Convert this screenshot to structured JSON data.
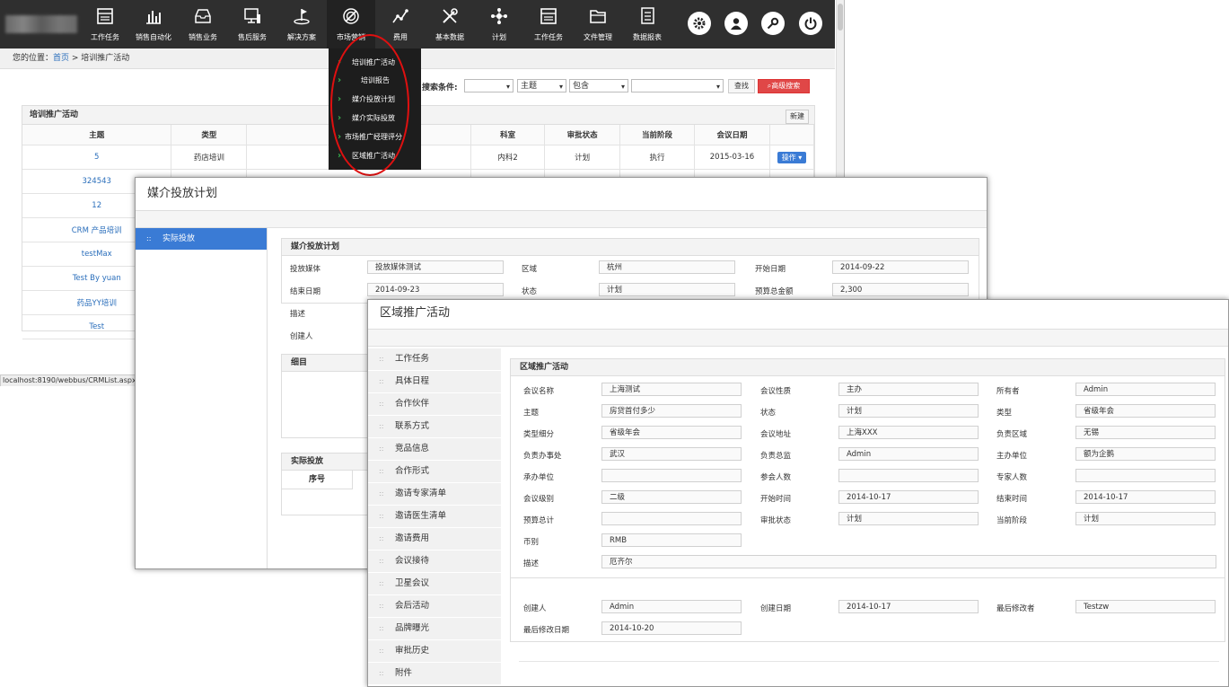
{
  "nav": {
    "items": [
      {
        "label": "工作任务",
        "icon": "task-board-icon"
      },
      {
        "label": "销售自动化",
        "icon": "bar-chart-icon"
      },
      {
        "label": "销售业务",
        "icon": "inbox-tray-icon"
      },
      {
        "label": "售后服务",
        "icon": "monitor-icon"
      },
      {
        "label": "解决方案",
        "icon": "flag-icon"
      },
      {
        "label": "市场营销",
        "icon": "target-icon"
      },
      {
        "label": "费用",
        "icon": "line-graph-icon"
      },
      {
        "label": "基本数据",
        "icon": "tools-icon"
      },
      {
        "label": "计划",
        "icon": "network-icon"
      },
      {
        "label": "工作任务",
        "icon": "task-board-icon"
      },
      {
        "label": "文件管理",
        "icon": "folder-icon"
      },
      {
        "label": "数据报表",
        "icon": "document-icon"
      }
    ],
    "round_icons": [
      "gear-icon",
      "user-icon",
      "key-icon",
      "power-icon"
    ]
  },
  "breadcrumb": {
    "prefix": "您的位置：",
    "home": "首页",
    "sep": " > ",
    "current": "培训推广活动"
  },
  "dropdown": [
    "培训推广活动",
    "培训报告",
    "媒介投放计划",
    "媒介实际投放",
    "市场推广经理评分",
    "区域推广活动"
  ],
  "search": {
    "label": "搜索条件:",
    "field1": "",
    "field2": "主题",
    "op": "包含",
    "value": "",
    "find": "查找",
    "advanced": "高级搜索"
  },
  "list_panel": {
    "title": "培训推广活动",
    "new_btn": "新建",
    "headers": [
      "主题",
      "类型",
      "",
      "科室",
      "审批状态",
      "当前阶段",
      "会议日期",
      ""
    ],
    "rows": [
      [
        "5",
        "药店培训",
        "",
        "内科2",
        "计划",
        "执行",
        "2015-03-16",
        "操作"
      ],
      [
        "324543",
        "",
        "",
        "",
        "",
        "",
        "",
        ""
      ],
      [
        "12",
        "",
        "",
        "",
        "",
        "",
        "",
        ""
      ],
      [
        "CRM 产品培训",
        "",
        "",
        "",
        "",
        "",
        "",
        ""
      ],
      [
        "testMax",
        "",
        "",
        "",
        "",
        "",
        "",
        ""
      ],
      [
        "Test By yuan",
        "",
        "",
        "",
        "",
        "",
        "",
        ""
      ],
      [
        "药品YY培训",
        "",
        "",
        "",
        "",
        "",
        "",
        ""
      ],
      [
        "Test",
        "",
        "",
        "",
        "",
        "",
        "",
        ""
      ]
    ]
  },
  "status_url": "localhost:8190/webbus/CRMList.aspx",
  "media_plan": {
    "window_title": "媒介投放计划",
    "nav": [
      "实际投放"
    ],
    "section_title": "媒介投放计划",
    "fields": [
      {
        "label": "投放媒体",
        "value": "投放媒体测试"
      },
      {
        "label": "区域",
        "value": "杭州"
      },
      {
        "label": "开始日期",
        "value": "2014-09-22"
      },
      {
        "label": "结束日期",
        "value": "2014-09-23"
      },
      {
        "label": "状态",
        "value": "计划"
      },
      {
        "label": "预算总金额",
        "value": "2,300"
      },
      {
        "label": "描述",
        "value": ""
      },
      {
        "label": "创建人",
        "value": ""
      }
    ],
    "detail_title": "细目",
    "actual_title": "实际投放",
    "actual_headers": [
      "序号"
    ]
  },
  "region": {
    "window_title": "区域推广活动",
    "tabs": [
      "工作任务",
      "具体日程",
      "合作伙伴",
      "联系方式",
      "竞品信息",
      "合作形式",
      "邀请专家清单",
      "邀请医生清单",
      "邀请费用",
      "会议接待",
      "卫星会议",
      "会后活动",
      "品牌曝光",
      "审批历史",
      "附件"
    ],
    "section_title": "区域推广活动",
    "fields": [
      {
        "label": "会议名称",
        "value": "上海测试"
      },
      {
        "label": "会议性质",
        "value": "主办"
      },
      {
        "label": "所有者",
        "value": "Admin"
      },
      {
        "label": "主题",
        "value": "房贷首付多少"
      },
      {
        "label": "状态",
        "value": "计划"
      },
      {
        "label": "类型",
        "value": "省级年会"
      },
      {
        "label": "类型细分",
        "value": "省级年会"
      },
      {
        "label": "会议地址",
        "value": "上海XXX"
      },
      {
        "label": "负责区域",
        "value": "无锡"
      },
      {
        "label": "负责办事处",
        "value": "武汉"
      },
      {
        "label": "负责总监",
        "value": "Admin"
      },
      {
        "label": "主办单位",
        "value": "额为企鹅"
      },
      {
        "label": "承办单位",
        "value": ""
      },
      {
        "label": "参会人数",
        "value": ""
      },
      {
        "label": "专家人数",
        "value": ""
      },
      {
        "label": "会议级别",
        "value": "二级"
      },
      {
        "label": "开始时间",
        "value": "2014-10-17"
      },
      {
        "label": "结束时间",
        "value": "2014-10-17"
      },
      {
        "label": "预算总计",
        "value": ""
      },
      {
        "label": "审批状态",
        "value": "计划"
      },
      {
        "label": "当前阶段",
        "value": "计划"
      },
      {
        "label": "币别",
        "value": "RMB"
      }
    ],
    "desc": {
      "label": "描述",
      "value": "厄齐尔"
    },
    "meta": [
      {
        "label": "创建人",
        "value": "Admin"
      },
      {
        "label": "创建日期",
        "value": "2014-10-17"
      },
      {
        "label": "最后修改者",
        "value": "Testzw"
      },
      {
        "label": "最后修改日期",
        "value": "2014-10-20"
      }
    ]
  }
}
